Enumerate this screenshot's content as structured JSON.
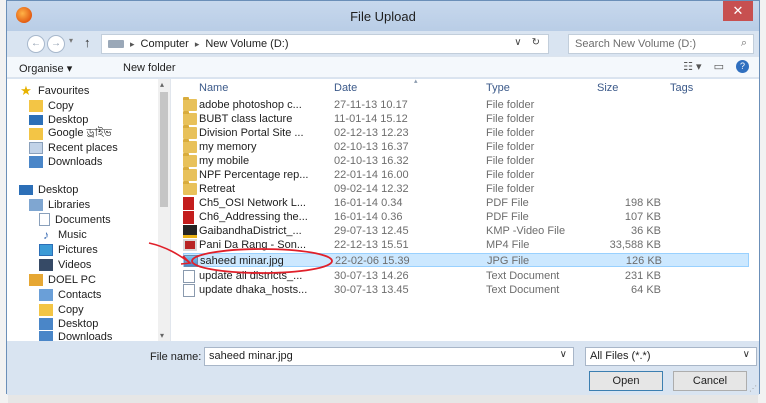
{
  "window": {
    "title": "File Upload",
    "close_label": "✕"
  },
  "address": {
    "crumbs": [
      "Computer",
      "New Volume (D:)"
    ],
    "search_placeholder": "Search New Volume (D:)"
  },
  "toolbar": {
    "organise_label": "Organise ▾",
    "new_folder_label": "New folder"
  },
  "nav": {
    "items": [
      {
        "label": "Favourites",
        "icon": "star-icon"
      },
      {
        "label": "Copy",
        "icon": "copy-folder-icon"
      },
      {
        "label": "Desktop",
        "icon": "desktop-icon"
      },
      {
        "label": "Google ড্রাইভ",
        "icon": "google-drive-icon"
      },
      {
        "label": "Recent places",
        "icon": "recent-places-icon"
      },
      {
        "label": "Downloads",
        "icon": "downloads-icon"
      },
      {
        "label": "Desktop",
        "icon": "desktop-icon"
      },
      {
        "label": "Libraries",
        "icon": "libraries-icon"
      },
      {
        "label": "Documents",
        "icon": "documents-icon"
      },
      {
        "label": "Music",
        "icon": "music-icon"
      },
      {
        "label": "Pictures",
        "icon": "pictures-icon"
      },
      {
        "label": "Videos",
        "icon": "videos-icon"
      },
      {
        "label": "DOEL PC",
        "icon": "user-folder-icon"
      },
      {
        "label": "Contacts",
        "icon": "contacts-icon"
      },
      {
        "label": "Copy",
        "icon": "copy-folder-icon"
      },
      {
        "label": "Desktop",
        "icon": "desktop-icon"
      },
      {
        "label": "Downloads",
        "icon": "downloads-icon"
      }
    ]
  },
  "columns": {
    "name": "Name",
    "date": "Date",
    "type": "Type",
    "size": "Size",
    "tags": "Tags"
  },
  "files": [
    {
      "name": "adobe photoshop c...",
      "date": "27-11-13 10.17",
      "type": "File folder",
      "size": "",
      "icon": "folder-icon"
    },
    {
      "name": "BUBT class lacture",
      "date": "11-01-14 15.12",
      "type": "File folder",
      "size": "",
      "icon": "folder-icon"
    },
    {
      "name": "Division Portal Site ...",
      "date": "02-12-13 12.23",
      "type": "File folder",
      "size": "",
      "icon": "folder-icon"
    },
    {
      "name": "my memory",
      "date": "02-10-13 16.37",
      "type": "File folder",
      "size": "",
      "icon": "folder-icon"
    },
    {
      "name": "my mobile",
      "date": "02-10-13 16.32",
      "type": "File folder",
      "size": "",
      "icon": "folder-icon"
    },
    {
      "name": "NPF Percentage rep...",
      "date": "22-01-14 16.00",
      "type": "File folder",
      "size": "",
      "icon": "folder-icon"
    },
    {
      "name": "Retreat",
      "date": "09-02-14 12.32",
      "type": "File folder",
      "size": "",
      "icon": "folder-icon"
    },
    {
      "name": "Ch5_OSI Network L...",
      "date": "16-01-14 0.34",
      "type": "PDF File",
      "size": "198 KB",
      "icon": "pdf-icon"
    },
    {
      "name": "Ch6_Addressing the...",
      "date": "16-01-14 0.36",
      "type": "PDF File",
      "size": "107 KB",
      "icon": "pdf-icon"
    },
    {
      "name": "GaibandhaDistrict_...",
      "date": "29-07-13 12.45",
      "type": "KMP -Video File",
      "size": "36 KB",
      "icon": "kmp-video-icon"
    },
    {
      "name": "Pani Da Rang - Son...",
      "date": "22-12-13 15.51",
      "type": "MP4 File",
      "size": "33,588 KB",
      "icon": "mp4-video-icon"
    },
    {
      "name": "saheed minar.jpg",
      "date": "22-02-06 15.39",
      "type": "JPG File",
      "size": "126 KB",
      "icon": "jpg-image-icon",
      "selected": true
    },
    {
      "name": "update all districts_...",
      "date": "30-07-13 14.26",
      "type": "Text Document",
      "size": "231 KB",
      "icon": "text-document-icon"
    },
    {
      "name": "update dhaka_hosts...",
      "date": "30-07-13 13.45",
      "type": "Text Document",
      "size": "64 KB",
      "icon": "text-document-icon"
    }
  ],
  "footer": {
    "file_name_label": "File name:",
    "file_name_value": "saheed minar.jpg",
    "file_type_value": "All Files (*.*)",
    "open_label": "Open",
    "cancel_label": "Cancel"
  },
  "colors": {
    "selection": "#cce8ff",
    "annotation": "#e0202a",
    "title_bar": "#c7d8ed",
    "close_button": "#c75050"
  }
}
